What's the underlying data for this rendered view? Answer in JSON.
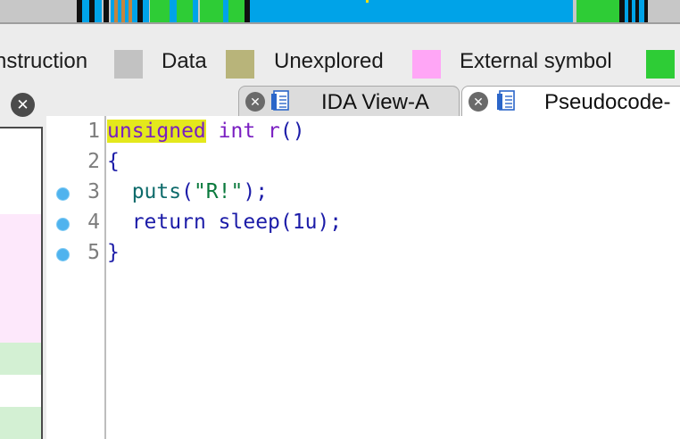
{
  "colors": {
    "instruction": "#a3a3a3",
    "data": "#c2c2c2",
    "unexplored": "#b8b47a",
    "external_symbol": "#ffa6f6",
    "lib_function": "#2ecc36",
    "nav_function": "#00a3e8",
    "nav_dark": "#101010",
    "nav_orange": "#c6843e",
    "breakpoint": "#4fb3ee"
  },
  "legend": {
    "items": [
      {
        "label": "nstruction"
      },
      {
        "label": "Data"
      },
      {
        "label": "Unexplored"
      },
      {
        "label": "External symbol"
      }
    ]
  },
  "tabs": [
    {
      "label": "IDA View-A",
      "icon": "document-icon",
      "close_icon": "close-icon"
    },
    {
      "label": "Pseudocode-",
      "icon": "document-icon",
      "close_icon": "close-icon"
    }
  ],
  "left_panel": {
    "close_icon": "close-icon"
  },
  "editor": {
    "lines": [
      {
        "number": "1",
        "breakpoint": false,
        "tokens": [
          {
            "text": "unsigned",
            "kind": "keyword-hl"
          },
          {
            "text": " ",
            "kind": "plain"
          },
          {
            "text": "int",
            "kind": "keyword"
          },
          {
            "text": " ",
            "kind": "plain"
          },
          {
            "text": "r",
            "kind": "keyword"
          },
          {
            "text": "()",
            "kind": "punct"
          }
        ]
      },
      {
        "number": "2",
        "breakpoint": false,
        "tokens": [
          {
            "text": "{",
            "kind": "punct"
          }
        ]
      },
      {
        "number": "3",
        "breakpoint": true,
        "tokens": [
          {
            "text": "  ",
            "kind": "plain"
          },
          {
            "text": "puts",
            "kind": "call"
          },
          {
            "text": "(",
            "kind": "punct"
          },
          {
            "text": "\"R!\"",
            "kind": "string"
          },
          {
            "text": ");",
            "kind": "punct"
          }
        ]
      },
      {
        "number": "4",
        "breakpoint": true,
        "tokens": [
          {
            "text": "  ",
            "kind": "plain"
          },
          {
            "text": "return",
            "kind": "ident"
          },
          {
            "text": " ",
            "kind": "plain"
          },
          {
            "text": "sleep",
            "kind": "ident"
          },
          {
            "text": "(1u);",
            "kind": "punct"
          }
        ]
      },
      {
        "number": "5",
        "breakpoint": true,
        "tokens": [
          {
            "text": "}",
            "kind": "punct"
          }
        ]
      }
    ]
  }
}
